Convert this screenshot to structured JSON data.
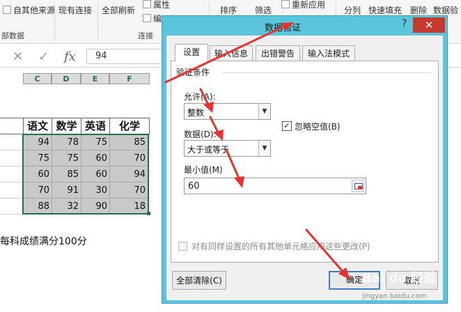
{
  "ribbon": {
    "items": [
      "自其他来源",
      "现有连接",
      "全部刷新",
      "属性",
      "编",
      "排序",
      "筛选",
      "重新应用",
      "分列",
      "快速填充",
      "删除",
      "数据验"
    ],
    "groups": [
      "部数据",
      "连接"
    ]
  },
  "formula_bar": {
    "cancel_icon": "✕",
    "enter_icon": "✓",
    "fx_label": "fx",
    "value": "94"
  },
  "sheet": {
    "columns": [
      "C",
      "D",
      "E",
      "F"
    ],
    "headers": [
      "语文",
      "数学",
      "英语",
      "化学"
    ],
    "rows": [
      [
        "94",
        "78",
        "75",
        "85"
      ],
      [
        "75",
        "75",
        "60",
        "70"
      ],
      [
        "60",
        "85",
        "60",
        "94"
      ],
      [
        "70",
        "91",
        "30",
        "70"
      ],
      [
        "88",
        "32",
        "90",
        "18"
      ]
    ],
    "note": "每科成绩满分100分"
  },
  "dialog": {
    "title": "数据验证",
    "help": "?",
    "close": "✕",
    "tabs": [
      "设置",
      "输入信息",
      "出错警告",
      "输入法模式"
    ],
    "group_label": "验证条件",
    "allow_label": "允许(A):",
    "allow_value": "整数",
    "ignore_blank_label": "忽略空值(B)",
    "ignore_blank_checked": "✓",
    "data_label": "数据(D):",
    "data_value": "大于或等于",
    "min_label": "最小值(M)",
    "min_value": "60",
    "apply_all_label": "对有同样设置的所有其他单元格应用这些更改(P)",
    "clear_all": "全部清除(C)",
    "ok": "确定",
    "cancel": "取消"
  },
  "watermark": {
    "logo": "Bai du 经验",
    "url": "jingyan.baidu.com"
  },
  "colors": {
    "dialog_frame": "#5ac5db",
    "close_button": "#c9382c",
    "selection_border": "#217346",
    "arrow": "#e8322e"
  }
}
